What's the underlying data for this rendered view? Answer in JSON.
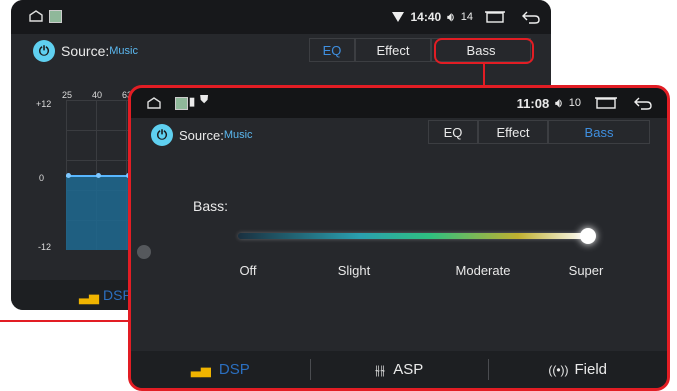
{
  "colors": {
    "accent": "#3f8fe0",
    "highlight": "#e21d24",
    "power": "#5fd0f0"
  },
  "back_screen": {
    "status": {
      "time": "14:40",
      "volume": "14",
      "wifi_icon": "wifi-icon",
      "volume_icon": "volume-icon",
      "recent_icon": "recent-apps-icon",
      "back_icon": "back-arrow-icon"
    },
    "source_label": "Source:",
    "source_value": "Music",
    "tabs": [
      "EQ",
      "Effect",
      "Bass"
    ],
    "eq": {
      "y_labels": [
        "+12",
        "0",
        "-12"
      ],
      "x_labels": [
        "25",
        "40",
        "63"
      ]
    },
    "bottom_label": "DSP"
  },
  "front_screen": {
    "status": {
      "time": "11:08",
      "volume": "10"
    },
    "source_label": "Source:",
    "source_value": "Music",
    "tabs": [
      "EQ",
      "Effect",
      "Bass"
    ],
    "bass_label": "Bass:",
    "bass_levels": [
      "Off",
      "Slight",
      "Moderate",
      "Super"
    ],
    "bass_level_selected": "Super",
    "bottom_tabs": [
      "DSP",
      "ASP",
      "Field"
    ]
  }
}
